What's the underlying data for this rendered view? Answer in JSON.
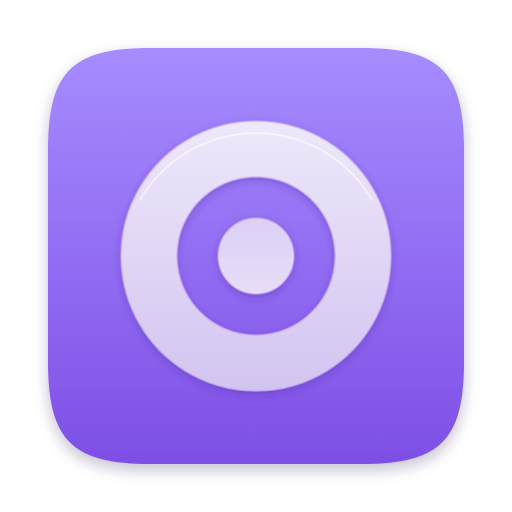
{
  "app_icon": {
    "name": "target-rings-icon",
    "colors": {
      "tile_top": "#A68CFF",
      "tile_bottom": "#7E4FE6",
      "ring_light": "#E9E2F8",
      "ring_shade": "#CFC0F0",
      "ring_highlight": "#FFFFFF",
      "ring_edge": "#C9A8F2"
    }
  }
}
